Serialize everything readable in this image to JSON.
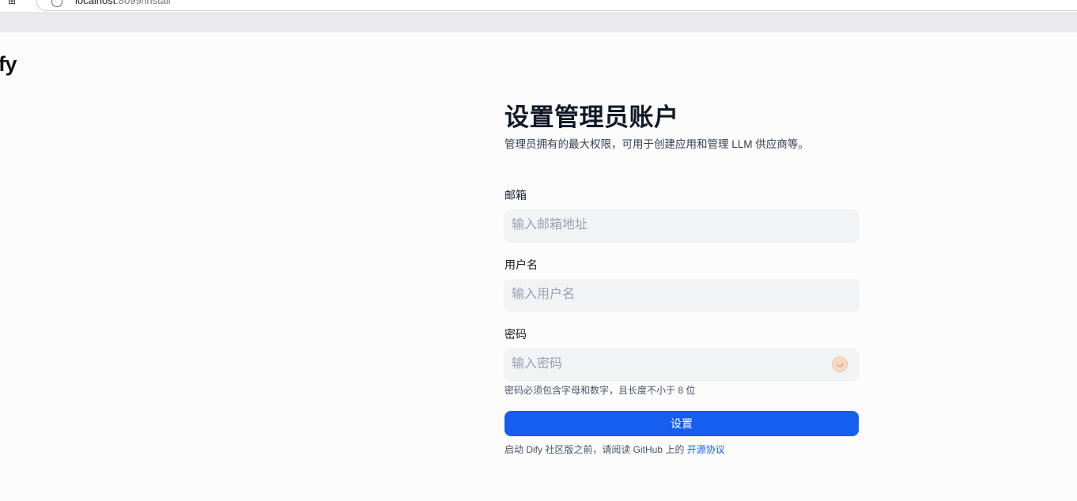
{
  "browser": {
    "url_host": "localhost",
    "url_path": ":8099/install"
  },
  "brand": {
    "logo_text": "ify"
  },
  "form": {
    "title": "设置管理员账户",
    "subtitle": "管理员拥有的最大权限，可用于创建应用和管理 LLM 供应商等。",
    "email": {
      "label": "邮箱",
      "placeholder": "输入邮箱地址",
      "value": ""
    },
    "username": {
      "label": "用户名",
      "placeholder": "输入用户名",
      "value": ""
    },
    "password": {
      "label": "密码",
      "placeholder": "输入密码",
      "value": "",
      "toggle_icon": "eye-toggle-icon",
      "hint": "密码必须包含字母和数字，且长度不小于 8 位"
    },
    "submit_label": "设置",
    "terms_text": "启动 Dify 社区版之前，请阅读 GitHub 上的",
    "terms_link": "开源协议"
  },
  "colors": {
    "accent": "#155eef",
    "input_bg": "#f2f3f5",
    "page_bg": "#fcfcfc"
  }
}
